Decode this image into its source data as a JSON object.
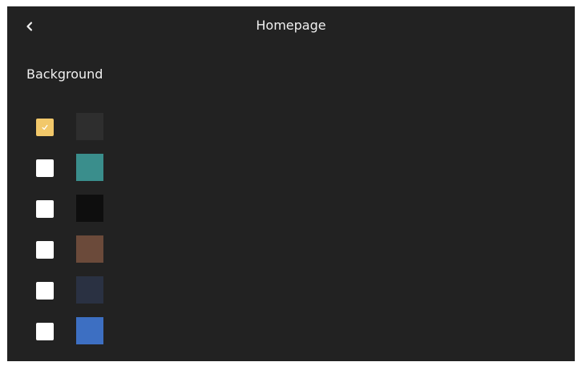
{
  "header": {
    "title": "Homepage",
    "back_icon": "chevron-left-icon"
  },
  "section": {
    "label": "Background"
  },
  "colors": {
    "selected_index": 0,
    "accent": "#f2c86a",
    "options": [
      {
        "swatch": "#2e2e2e",
        "checked": true
      },
      {
        "swatch": "#3a8e8c",
        "checked": false
      },
      {
        "swatch": "#0e0e0e",
        "checked": false
      },
      {
        "swatch": "#6b4a3a",
        "checked": false
      },
      {
        "swatch": "#2a3142",
        "checked": false
      },
      {
        "swatch": "#3d6fc2",
        "checked": false
      }
    ]
  }
}
